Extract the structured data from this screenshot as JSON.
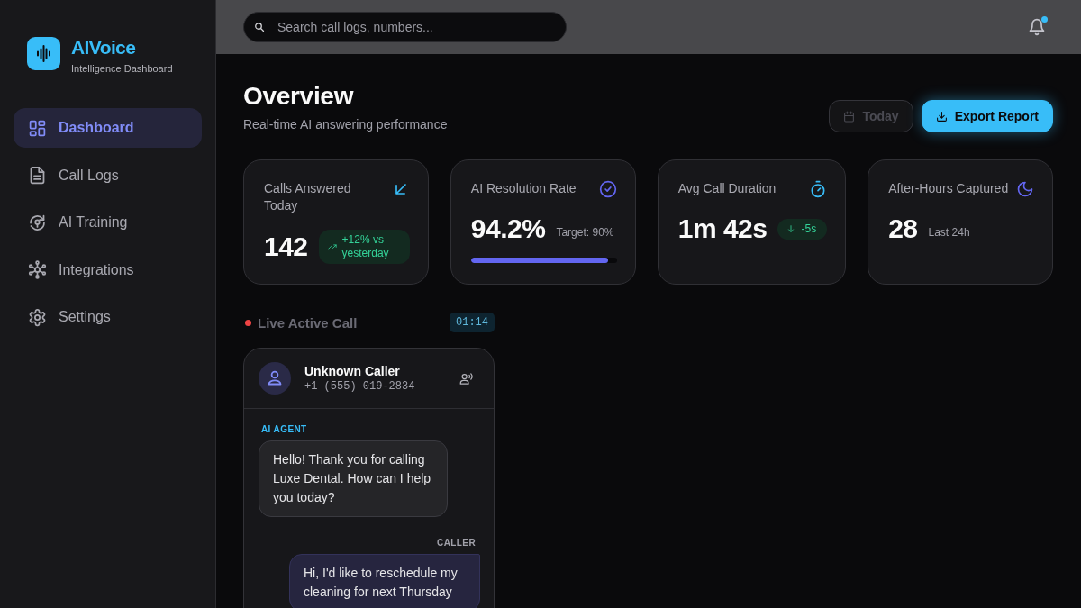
{
  "sidebar": {
    "brand": {
      "name": "AIVoice",
      "tagline": "Intelligence Dashboard"
    },
    "items": [
      {
        "label": "Dashboard",
        "selected": true
      },
      {
        "label": "Call Logs",
        "selected": false
      },
      {
        "label": "AI Training",
        "selected": false
      },
      {
        "label": "Integrations",
        "selected": false
      },
      {
        "label": "Settings",
        "selected": false
      }
    ]
  },
  "topbar": {
    "search": {
      "placeholder": "Search call logs, numbers..."
    },
    "notifications": {
      "unread": true
    }
  },
  "header": {
    "title": "Overview",
    "subtitle": "Real-time AI answering performance",
    "buttons": [
      {
        "label": "Today",
        "kind": "secondary",
        "disabled": true
      },
      {
        "label": "Export Report",
        "kind": "primary",
        "disabled": false
      }
    ]
  },
  "stats": [
    {
      "title": "Calls Answered Today",
      "value": "142",
      "note": {
        "kind": "rise",
        "text": "+12% vs yesterday"
      }
    },
    {
      "title": "AI Resolution Rate",
      "value": "94.2%",
      "note": {
        "kind": "caption",
        "text": "Target: 90%"
      },
      "level": 0.94
    },
    {
      "title": "Avg Call Duration",
      "value": "1m 42s",
      "note": {
        "kind": "drop",
        "text": "-5s"
      }
    },
    {
      "title": "After-Hours Captured",
      "value": "28",
      "note": {
        "kind": "caption",
        "text": "Last 24h"
      }
    }
  ],
  "live_call": {
    "title": "Live Active Call",
    "live": true,
    "timer": "01:14",
    "caller": {
      "name": "Unknown Caller",
      "phone": "+1 (555) 019-2834"
    },
    "messages": [
      {
        "kind": "agent",
        "speaker": "AI AGENT",
        "text": "Hello! Thank you for calling Luxe Dental. How can I help you today?"
      },
      {
        "kind": "caller",
        "speaker": "CALLER",
        "text": "Hi, I'd like to reschedule my cleaning for next Thursday"
      }
    ]
  }
}
